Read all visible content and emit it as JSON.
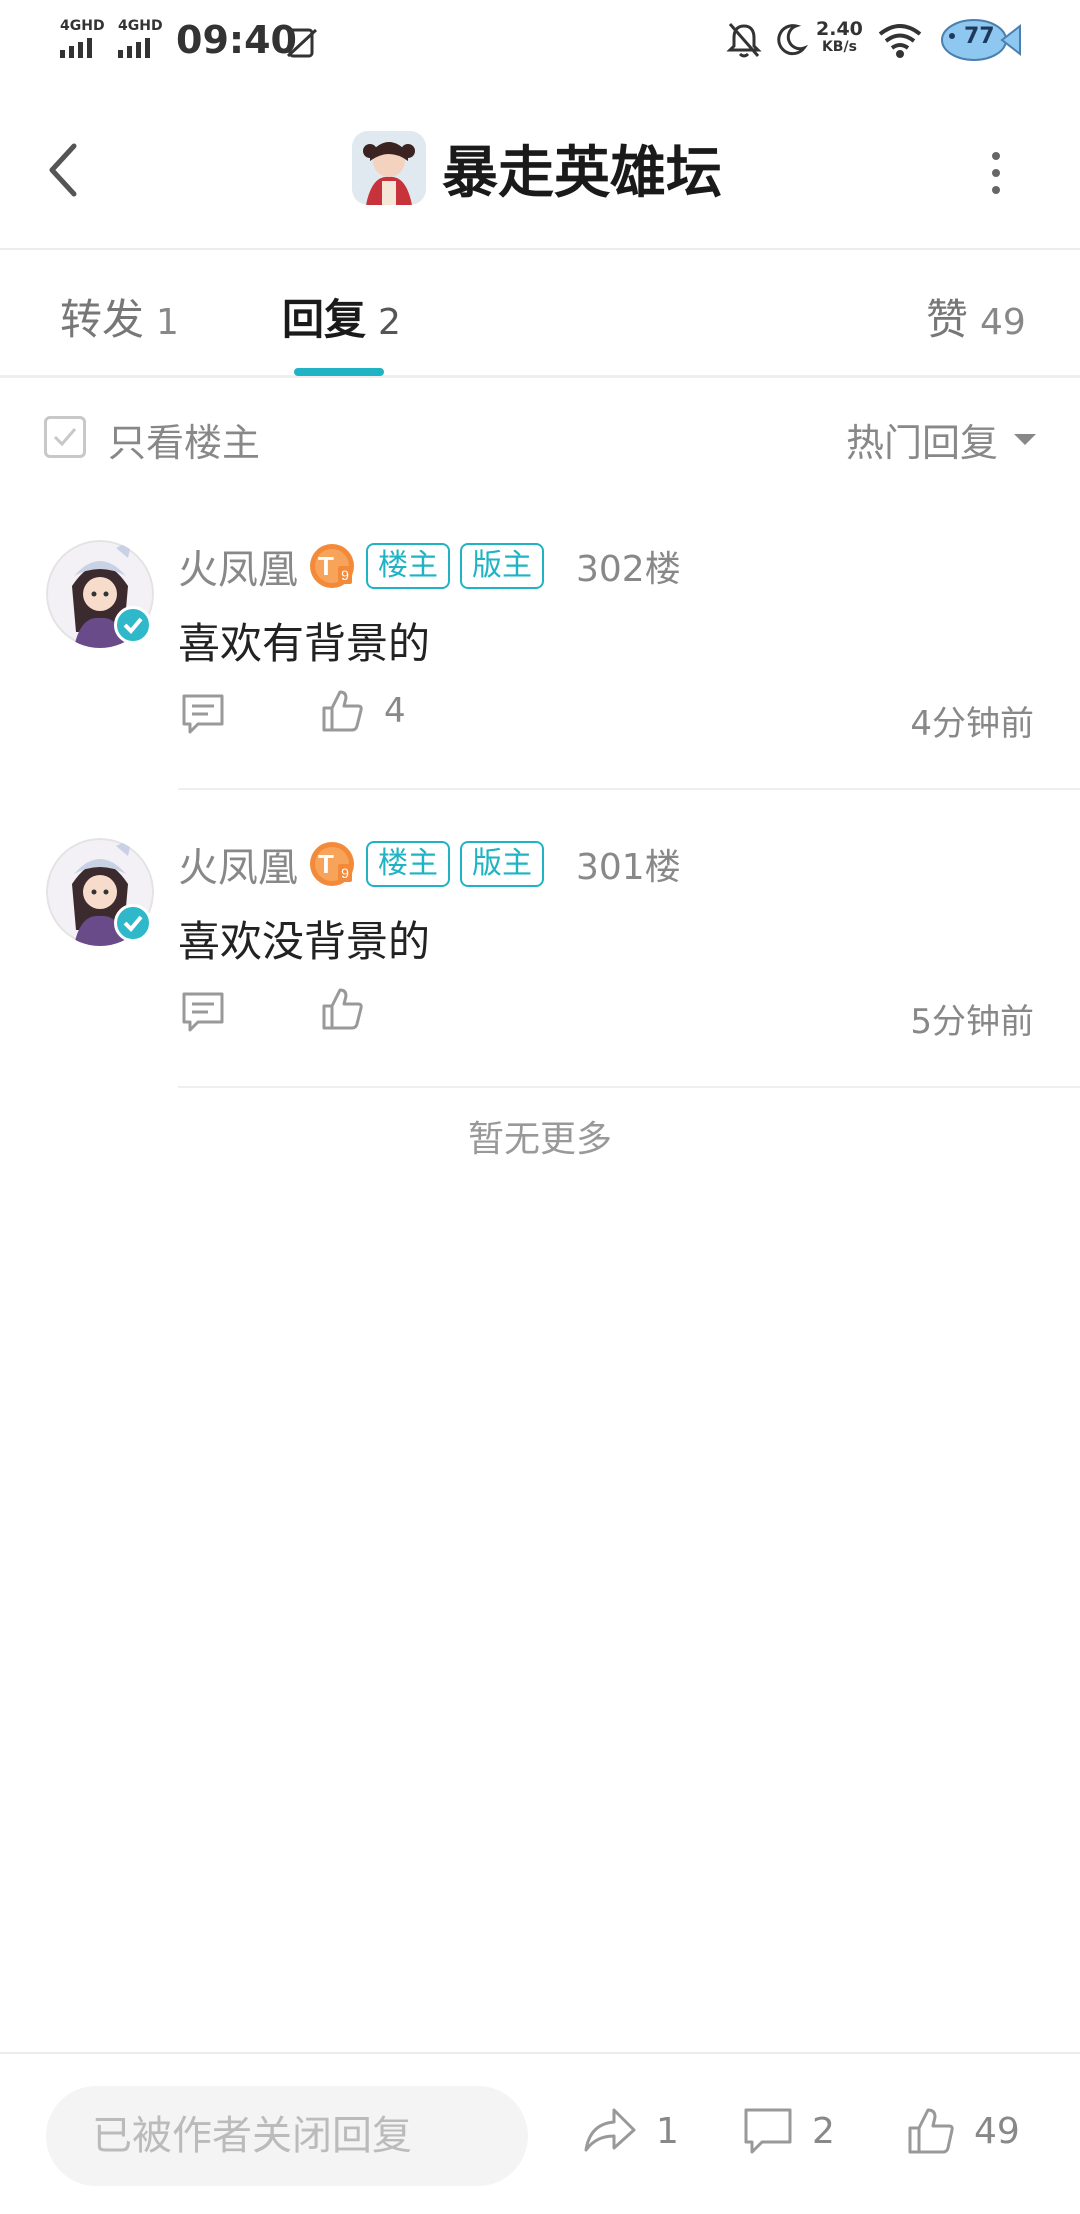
{
  "status_bar": {
    "network_1": "4GHD",
    "network_2": "4GHD",
    "time": "09:40",
    "speed_value": "2.40",
    "speed_unit": "KB/s",
    "battery": "77",
    "icons": [
      "mute-bell-icon",
      "moon-icon",
      "wifi-icon",
      "fish-battery-icon",
      "sim-icon"
    ]
  },
  "header": {
    "title": "暴走英雄坛",
    "back_icon": "chevron-left-icon",
    "more_icon": "more-vertical-icon"
  },
  "tabs": [
    {
      "label": "转发",
      "count": "1"
    },
    {
      "label": "回复",
      "count": "2",
      "active": true
    },
    {
      "label": "赞",
      "count": "49"
    }
  ],
  "filter": {
    "only_author_label": "只看楼主",
    "sort_label": "热门回复"
  },
  "replies": [
    {
      "username": "火凤凰",
      "tags": [
        "楼主",
        "版主"
      ],
      "floor": "302楼",
      "content": "喜欢有背景的",
      "likes": "4",
      "time": "4分钟前"
    },
    {
      "username": "火凤凰",
      "tags": [
        "楼主",
        "版主"
      ],
      "floor": "301楼",
      "content": "喜欢没背景的",
      "likes": "",
      "time": "5分钟前"
    }
  ],
  "no_more": "暂无更多",
  "bottom_bar": {
    "closed_placeholder": "已被作者关闭回复",
    "share_count": "1",
    "comment_count": "2",
    "like_count": "49"
  },
  "colors": {
    "accent": "#1fb3c4",
    "level_badge": "#f28a3a",
    "muted_text": "#888888"
  }
}
